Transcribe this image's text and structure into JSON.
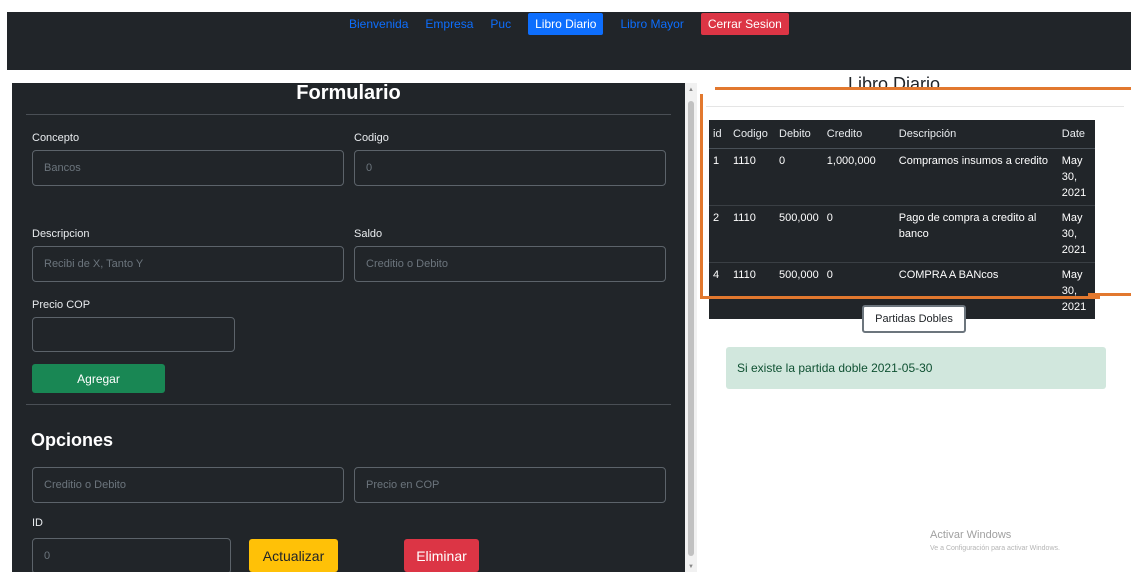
{
  "nav": {
    "items": [
      "Bienvenida",
      "Empresa",
      "Puc",
      "Libro Diario",
      "Libro Mayor",
      "Cerrar Sesion"
    ]
  },
  "form": {
    "title": "Formulario",
    "concepto_label": "Concepto",
    "concepto_placeholder": "Bancos",
    "codigo_label": "Codigo",
    "codigo_placeholder": "0",
    "descripcion_label": "Descripcion",
    "descripcion_placeholder": "Recibi de X, Tanto Y",
    "saldo_label": "Saldo",
    "saldo_placeholder": "Creditio o Debito",
    "precio_label": "Precio COP",
    "precio_value": "",
    "agregar_label": "Agregar"
  },
  "opciones": {
    "title": "Opciones",
    "tipo_placeholder": "Creditio o Debito",
    "precio_placeholder": "Precio en COP",
    "id_label": "ID",
    "id_placeholder": "0",
    "actualizar_label": "Actualizar",
    "eliminar_label": "Eliminar"
  },
  "libro": {
    "title": "Libro Diario",
    "columns": [
      "id",
      "Codigo",
      "Debito",
      "Credito",
      "Descripción",
      "Date"
    ],
    "rows": [
      [
        "1",
        "1110",
        "0",
        "1,000,000",
        "Compramos insumos a credito",
        "May 30, 2021"
      ],
      [
        "2",
        "1110",
        "500,000",
        "0",
        "Pago de compra a credito al banco",
        "May 30, 2021"
      ],
      [
        "4",
        "1110",
        "500,000",
        "0",
        "COMPRA A BANcos",
        "May 30, 2021"
      ]
    ],
    "partidas_label": "Partidas Dobles",
    "alert_text": "Si existe la partida doble 2021-05-30"
  },
  "watermark": {
    "line1": "Activar Windows",
    "line2": "Ve a Configuración para activar Windows."
  },
  "colors": {
    "dark": "#212529",
    "primary": "#0d6efd",
    "danger": "#dc3545",
    "success": "#198754",
    "warning": "#ffc107",
    "annotation": "#e2782e"
  }
}
